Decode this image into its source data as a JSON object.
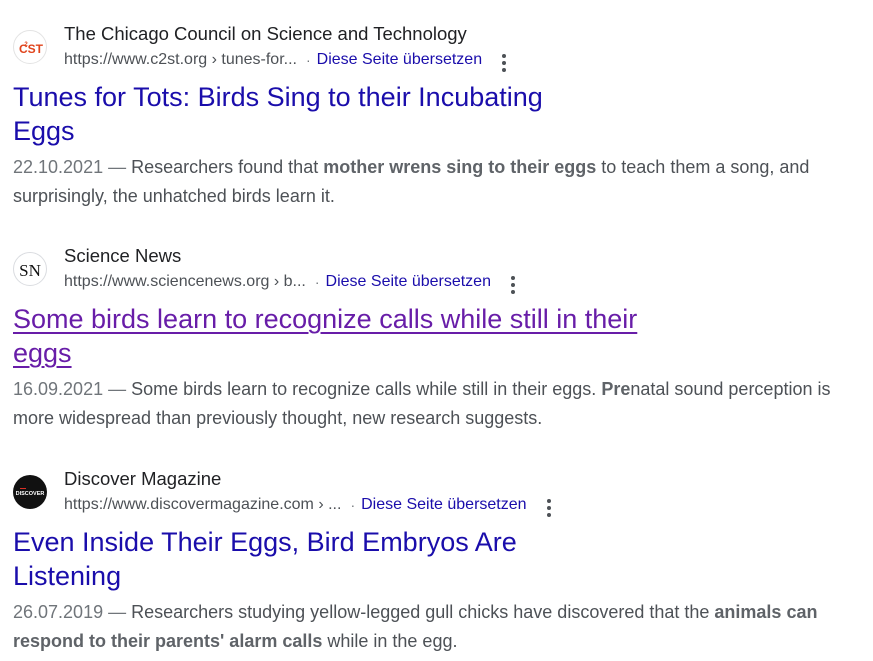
{
  "results": [
    {
      "site_name": "The Chicago Council on Science and Technology",
      "url": "https://www.c2st.org › tunes-for...",
      "translate_label": "Diese Seite übersetzen",
      "favicon_icon": "c2st-logo-icon",
      "title": "Tunes for Tots: Birds Sing to their Incubating Eggs",
      "date": "22.10.2021 — ",
      "snippet_pre": "Researchers found that ",
      "snippet_bold": "mother wrens sing to their eggs",
      "snippet_post": " to teach them a song, and surprisingly, the unhatched birds learn it.",
      "visited": false
    },
    {
      "site_name": "Science News",
      "url": "https://www.sciencenews.org › b...",
      "translate_label": "Diese Seite übersetzen",
      "favicon_icon": "science-news-logo-icon",
      "title": "Some birds learn to recognize calls while still in their eggs",
      "date": "16.09.2021 — ",
      "snippet_pre": "Some birds learn to recognize calls while still in their eggs. ",
      "snippet_bold": "Pre",
      "snippet_post": "natal sound perception is more widespread than previously thought, new research suggests.",
      "visited": true
    },
    {
      "site_name": "Discover Magazine",
      "url": "https://www.discovermagazine.com › ...",
      "translate_label": "Diese Seite übersetzen",
      "favicon_icon": "discover-logo-icon",
      "title": "Even Inside Their Eggs, Bird Embryos Are Listening",
      "date": "26.07.2019 — ",
      "snippet_pre": "Researchers studying yellow-legged gull chicks have discovered that the ",
      "snippet_bold": "animals can respond to their parents' alarm calls",
      "snippet_post": " while in the egg.",
      "visited": false
    }
  ],
  "logos": {
    "c2st": "CST",
    "sn": "SN",
    "discover": "DISCOVER"
  },
  "colors": {
    "link": "#1a0dab",
    "visited_link": "#681da8",
    "snippet": "#4d5156",
    "c2st_red": "#e0441c"
  }
}
